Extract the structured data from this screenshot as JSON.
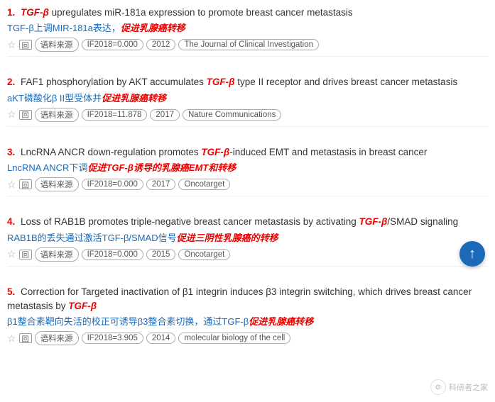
{
  "results": [
    {
      "num": "1.",
      "title_before": "",
      "title_italic": "TGF-β",
      "title_after": " upregulates miR-181a expression to promote breast cancer metastasis",
      "chinese_before": "TGF-β上调MIR-181a表达，",
      "chinese_italic": "促进乳腺癌转移",
      "chinese_after": "",
      "star": "☆",
      "cite_icon": "回",
      "tag1": "语料来源",
      "tag2": "IF2018=0.000",
      "tag3": "2012",
      "tag4": "The Journal of Clinical Investigation"
    },
    {
      "num": "2.",
      "title_before": "FAF1 phosphorylation by AKT accumulates ",
      "title_italic": "TGF-β",
      "title_after": " type II receptor and drives breast cancer metastasis",
      "chinese_before": "aKT磷酸化β II型受体并",
      "chinese_italic": "促进乳腺癌转移",
      "chinese_after": "",
      "star": "☆",
      "cite_icon": "回",
      "tag1": "语料来源",
      "tag2": "IF2018=11.878",
      "tag3": "2017",
      "tag4": "Nature Communications"
    },
    {
      "num": "3.",
      "title_before": "LncRNA ANCR down-regulation promotes ",
      "title_italic": "TGF-β",
      "title_after": "-induced EMT and metastasis in breast cancer",
      "chinese_before": "LncRNA ANCR下调",
      "chinese_italic": "促进TGF-β诱导的乳腺癌EMT和转移",
      "chinese_after": "",
      "star": "☆",
      "cite_icon": "回",
      "tag1": "语料来源",
      "tag2": "IF2018=0.000",
      "tag3": "2017",
      "tag4": "Oncotarget"
    },
    {
      "num": "4.",
      "title_before": "Loss of RAB1B promotes triple-negative breast cancer metastasis by activating ",
      "title_italic": "TGF-β",
      "title_after": "/SMAD signaling",
      "chinese_before": "RAB1B的丢失通过激活TGF-β/SMAD信号",
      "chinese_italic": "促进三阴性乳腺癌的转移",
      "chinese_after": "",
      "star": "☆",
      "cite_icon": "回",
      "tag1": "语料来源",
      "tag2": "IF2018=0.000",
      "tag3": "2015",
      "tag4": "Oncotarget"
    },
    {
      "num": "5.",
      "title_before": "Correction for Targeted inactivation of β1 integrin induces β3 integrin switching, which drives breast cancer metastasis by ",
      "title_italic": "TGF-β",
      "title_after": "",
      "chinese_before": "β1整合素靶向失活的校正可诱导β3整合素切换，通过TGF-β",
      "chinese_italic": "促进乳腺癌转移",
      "chinese_after": "",
      "star": "☆",
      "cite_icon": "回",
      "tag1": "语料来源",
      "tag2": "IF2018=3.905",
      "tag3": "2014",
      "tag4": "molecular biology of the cell"
    }
  ],
  "scroll_up": "↑",
  "watermark": "科研者之家"
}
